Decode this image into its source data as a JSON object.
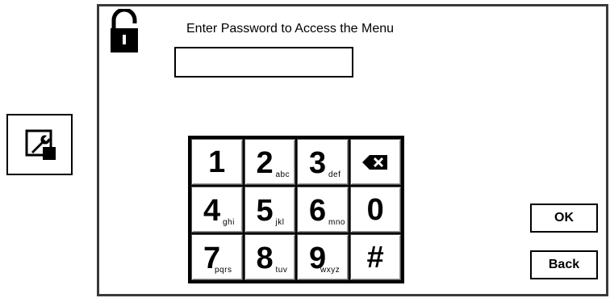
{
  "prompt": "Enter Password to Access the Menu",
  "password_value": "",
  "keypad": [
    {
      "digit": "1",
      "letters": ""
    },
    {
      "digit": "2",
      "letters": "abc"
    },
    {
      "digit": "3",
      "letters": "def"
    },
    {
      "icon": "backspace-icon"
    },
    {
      "digit": "4",
      "letters": "ghi"
    },
    {
      "digit": "5",
      "letters": "jkl"
    },
    {
      "digit": "6",
      "letters": "mno"
    },
    {
      "digit": "0",
      "letters": ""
    },
    {
      "digit": "7",
      "letters": "pqrs"
    },
    {
      "digit": "8",
      "letters": "tuv"
    },
    {
      "digit": "9",
      "letters": "wxyz"
    },
    {
      "digit": "#",
      "letters": ""
    }
  ],
  "buttons": {
    "ok": "OK",
    "back": "Back"
  },
  "icons": {
    "lock": "unlocked-padlock-icon",
    "tool": "wrench-settings-icon"
  }
}
